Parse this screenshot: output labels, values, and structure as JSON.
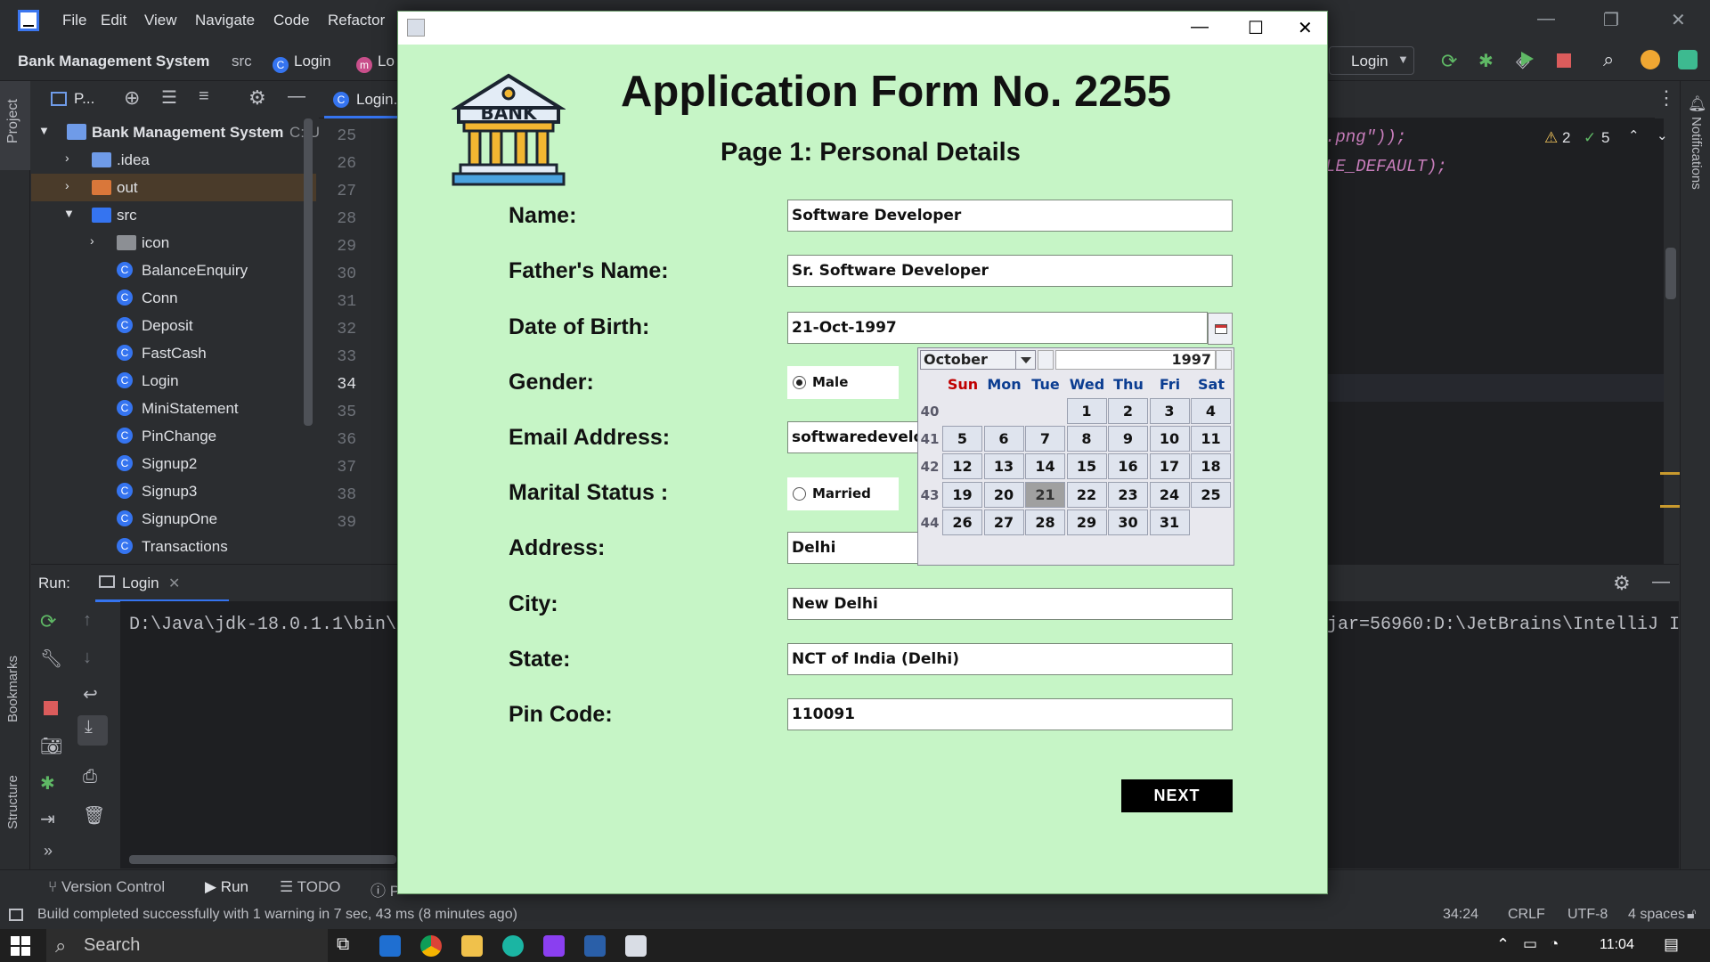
{
  "ide": {
    "menu": [
      "File",
      "Edit",
      "View",
      "Navigate",
      "Code",
      "Refactor"
    ],
    "breadcrumb": {
      "project": "Bank Management System",
      "src": "src",
      "file": "Login",
      "member": "Lo"
    },
    "run_config": "Login",
    "project_toolbar_label": "P...",
    "editor_tab": "Login.ja",
    "tree": {
      "root": "Bank Management System",
      "root_path": "C:\\U",
      "items": [
        ".idea",
        "out",
        "src",
        "icon",
        "BalanceEnquiry",
        "Conn",
        "Deposit",
        "FastCash",
        "Login",
        "MiniStatement",
        "PinChange",
        "Signup2",
        "Signup3",
        "SignupOne",
        "Transactions"
      ]
    },
    "line_numbers": [
      "25",
      "26",
      "27",
      "28",
      "29",
      "30",
      "31",
      "32",
      "33",
      "34",
      "35",
      "36",
      "37",
      "38",
      "39"
    ],
    "code_lines": [
      ".png\"));",
      "LE_DEFAULT);"
    ],
    "inspections": {
      "warnings": "2",
      "ok": "5"
    },
    "side_labels": {
      "project": "Project",
      "bookmarks": "Bookmarks",
      "structure": "Structure",
      "notifications": "Notifications"
    },
    "run": {
      "label": "Run:",
      "tab": "Login",
      "console_left": "D:\\Java\\jdk-18.0.1.1\\bin\\",
      "console_right": "jar=56960:D:\\JetBrains\\IntelliJ I"
    },
    "bottom_tabs": [
      "Version Control",
      "Run",
      "TODO",
      "P"
    ],
    "status": {
      "message": "Build completed successfully with 1 warning in 7 sec, 43 ms (8 minutes ago)",
      "position": "34:24",
      "line_sep": "CRLF",
      "encoding": "UTF-8",
      "indent": "4 spaces"
    },
    "taskbar": {
      "search": "Search",
      "time": "11:04"
    }
  },
  "form": {
    "logo_text": "BANK",
    "title": "Application Form No. 2255",
    "subtitle": "Page 1: Personal Details",
    "labels": {
      "name": "Name:",
      "father": "Father's Name:",
      "dob": "Date of Birth:",
      "gender": "Gender:",
      "email": "Email Address:",
      "marital": "Marital Status :",
      "address": "Address:",
      "city": "City:",
      "state": "State:",
      "pin": "Pin Code:"
    },
    "values": {
      "name": "Software Developer",
      "father": "Sr. Software Developer",
      "dob": "21-Oct-1997",
      "email": "softwaredevelop",
      "address": "Delhi",
      "city": "New Delhi",
      "state": "NCT of India (Delhi)",
      "pin": "110091"
    },
    "gender_option": "Male",
    "marital_option": "Married",
    "next_label": "NEXT"
  },
  "calendar": {
    "month": "October",
    "year": "1997",
    "days_of_week": [
      "Sun",
      "Mon",
      "Tue",
      "Wed",
      "Thu",
      "Fri",
      "Sat"
    ],
    "weeks": [
      {
        "num": "40",
        "days": [
          "",
          "",
          "",
          "1",
          "2",
          "3",
          "4"
        ]
      },
      {
        "num": "41",
        "days": [
          "5",
          "6",
          "7",
          "8",
          "9",
          "10",
          "11"
        ]
      },
      {
        "num": "42",
        "days": [
          "12",
          "13",
          "14",
          "15",
          "16",
          "17",
          "18"
        ]
      },
      {
        "num": "43",
        "days": [
          "19",
          "20",
          "21",
          "22",
          "23",
          "24",
          "25"
        ]
      },
      {
        "num": "44",
        "days": [
          "26",
          "27",
          "28",
          "29",
          "30",
          "31",
          ""
        ]
      }
    ],
    "selected_day": "21"
  }
}
